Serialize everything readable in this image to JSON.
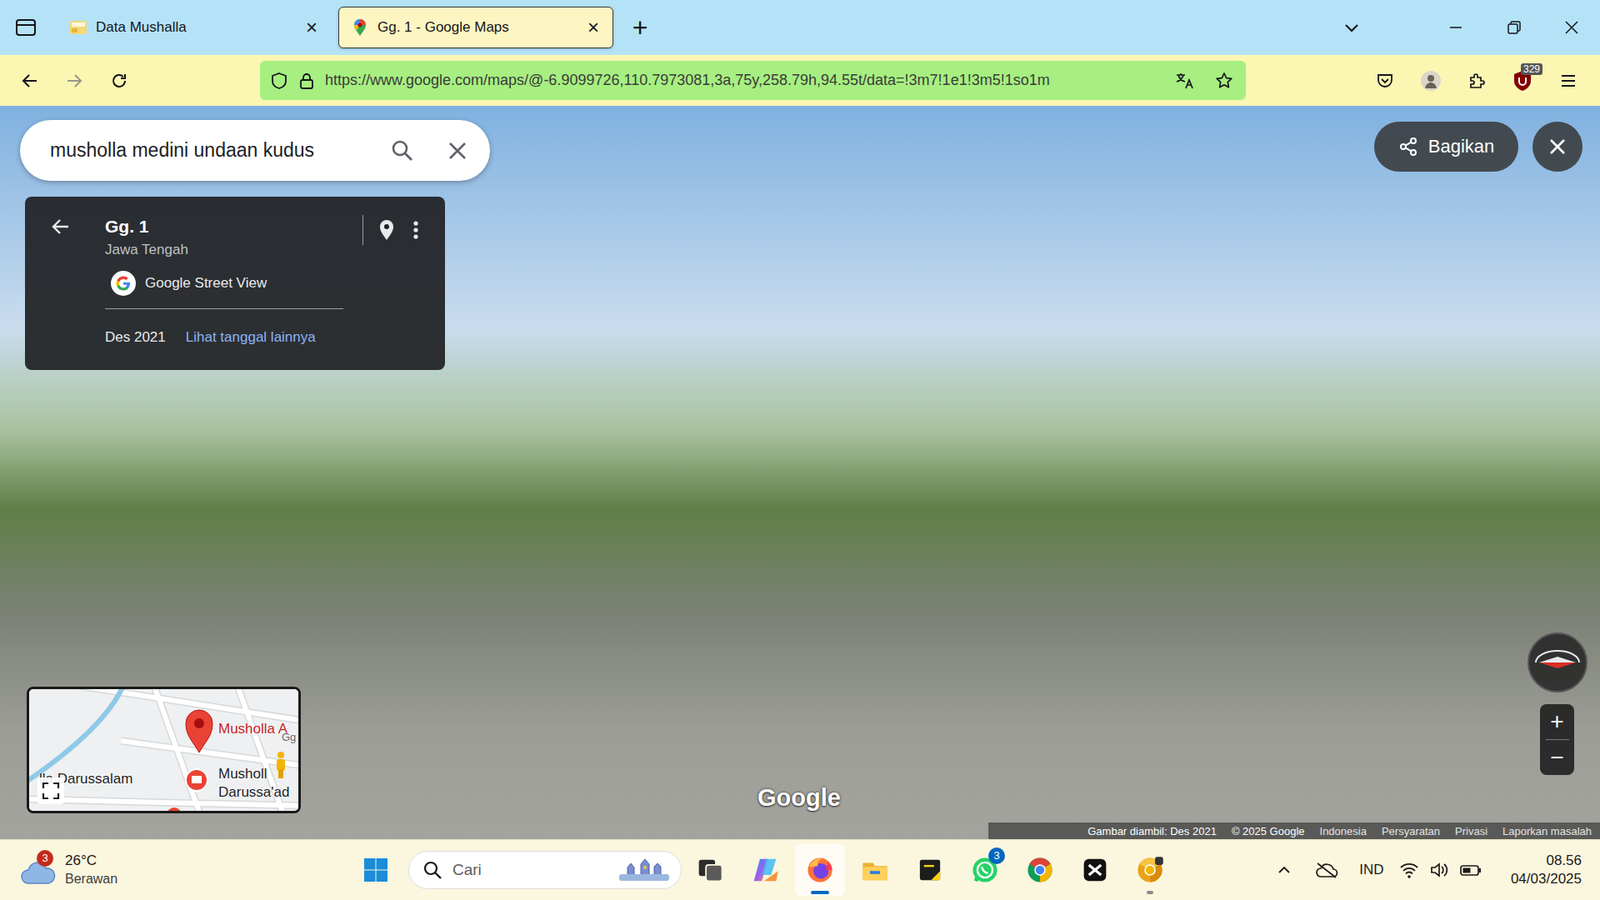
{
  "tabs": [
    {
      "label": "Data Mushalla",
      "selected": false,
      "close": "×"
    },
    {
      "label": "Gg. 1 - Google Maps",
      "selected": true,
      "close": "×"
    }
  ],
  "new_tab": "+",
  "address_bar": {
    "url": "https://www.google.com/maps/@-6.9099726,110.7973081,3a,75y,258.79h,94.55t/data=!3m7!1e1!3m5!1so1m"
  },
  "toolbar": {
    "forward_enabled": false,
    "extension_badge": "329"
  },
  "maps": {
    "search": {
      "value": "musholla medini undaan kudus"
    },
    "place_card": {
      "title": "Gg. 1",
      "subtitle": "Jawa Tengah",
      "source": "Google Street View",
      "date": "Des 2021",
      "more_dates": "Lihat tanggal lainnya"
    },
    "share_button": "Bagikan",
    "logo": "Google",
    "minimap": {
      "labels": [
        {
          "text": "Musholla A",
          "kind": "pin"
        },
        {
          "text": "lla Darussalam",
          "kind": "plain"
        },
        {
          "text": "Musholl",
          "kind": "place"
        },
        {
          "text": "Darussa'ad",
          "kind": "place"
        },
        {
          "text": "Gg",
          "kind": "road"
        }
      ]
    },
    "zoom": {
      "in": "+",
      "out": "−"
    },
    "footer": [
      "Gambar diambil: Des 2021",
      "© 2025 Google",
      "Indonesia",
      "Persyaratan",
      "Privasi",
      "Laporkan masalah"
    ]
  },
  "taskbar": {
    "weather": {
      "badge": "3",
      "temperature": "26°C",
      "condition": "Berawan"
    },
    "search": {
      "placeholder": "Cari"
    },
    "apps": [
      {
        "kind": "taskview",
        "running": false,
        "active": false,
        "badge": ""
      },
      {
        "kind": "copilot",
        "running": false,
        "active": false,
        "badge": ""
      },
      {
        "kind": "firefox",
        "running": true,
        "active": true,
        "badge": ""
      },
      {
        "kind": "explorer",
        "running": false,
        "active": false,
        "badge": ""
      },
      {
        "kind": "notes",
        "running": false,
        "active": false,
        "badge": ""
      },
      {
        "kind": "whatsapp",
        "running": false,
        "active": false,
        "badge": "3"
      },
      {
        "kind": "chrome",
        "running": false,
        "active": false,
        "badge": ""
      },
      {
        "kind": "capcut",
        "running": false,
        "active": false,
        "badge": ""
      },
      {
        "kind": "canary",
        "running": true,
        "active": false,
        "badge": ""
      }
    ],
    "tray": {
      "language": "IND"
    },
    "clock": {
      "time": "08.56",
      "date": "04/03/2025"
    }
  }
}
